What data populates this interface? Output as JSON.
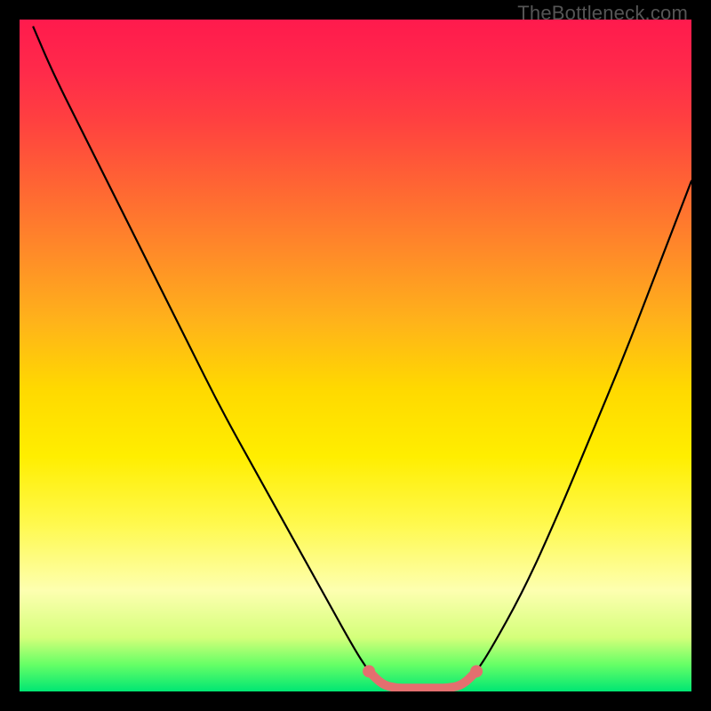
{
  "watermark": "TheBottleneck.com",
  "chart_data": {
    "type": "line",
    "title": "",
    "xlabel": "",
    "ylabel": "",
    "xlim": [
      0,
      100
    ],
    "ylim": [
      0,
      100
    ],
    "grid": false,
    "series": [
      {
        "name": "bottleneck-curve-left",
        "stroke": "#000000",
        "x": [
          2,
          5,
          10,
          15,
          20,
          25,
          30,
          35,
          40,
          45,
          50,
          52
        ],
        "values": [
          99,
          92,
          82,
          72,
          62,
          52,
          42,
          33,
          24,
          15,
          6,
          3
        ]
      },
      {
        "name": "bottleneck-curve-right",
        "stroke": "#000000",
        "x": [
          68,
          70,
          75,
          80,
          85,
          90,
          95,
          100
        ],
        "values": [
          3,
          6,
          15,
          26,
          38,
          50,
          63,
          76
        ]
      },
      {
        "name": "bottleneck-flat",
        "stroke": "#e36f6f",
        "x": [
          52,
          54,
          56,
          58,
          60,
          62,
          64,
          66,
          68
        ],
        "values": [
          3,
          1,
          0.5,
          0.5,
          0.5,
          0.5,
          0.5,
          1,
          3
        ]
      }
    ],
    "markers": [
      {
        "name": "flat-left-end",
        "x": 52,
        "y": 3,
        "color": "#e36f6f"
      },
      {
        "name": "flat-right-end",
        "x": 68,
        "y": 3,
        "color": "#e36f6f"
      }
    ],
    "background_gradient": {
      "stops": [
        {
          "pos": 0,
          "color": "#ff1a4d"
        },
        {
          "pos": 15,
          "color": "#ff4040"
        },
        {
          "pos": 35,
          "color": "#ff8c28"
        },
        {
          "pos": 55,
          "color": "#ffd900"
        },
        {
          "pos": 75,
          "color": "#fff94d"
        },
        {
          "pos": 92,
          "color": "#d4ff7a"
        },
        {
          "pos": 100,
          "color": "#00e673"
        }
      ]
    }
  }
}
